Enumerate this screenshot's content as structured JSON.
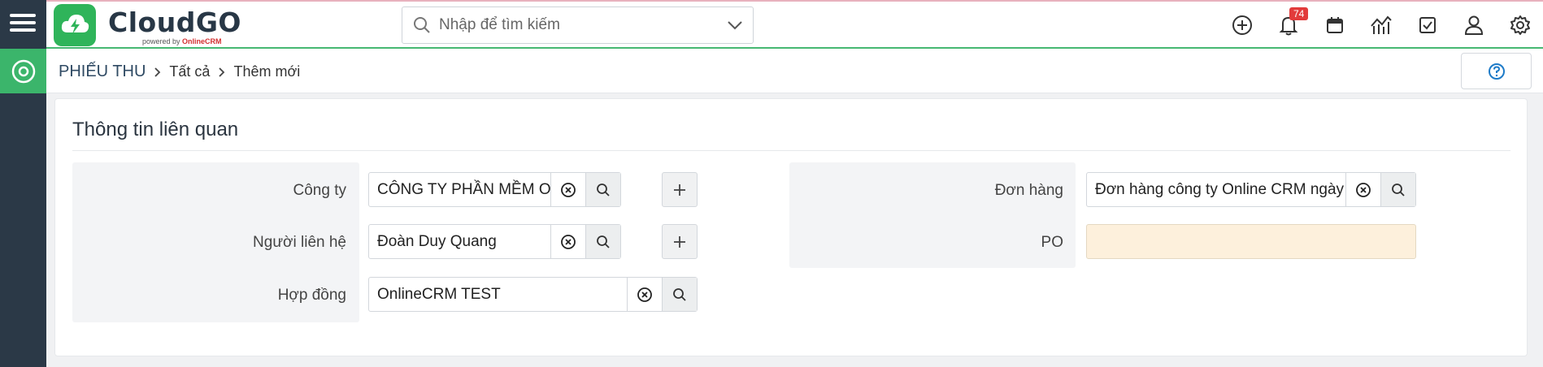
{
  "app": {
    "logo_title": "CloudGO",
    "logo_powered": "powered by",
    "logo_brand": "OnlineCRM"
  },
  "search": {
    "placeholder": "Nhập để tìm kiếm"
  },
  "notifications": {
    "count": "74"
  },
  "breadcrumb": {
    "module": "PHIẾU THU",
    "level1": "Tất cả",
    "level2": "Thêm mới"
  },
  "section": {
    "title": "Thông tin liên quan",
    "left_fields": [
      {
        "label": "Công ty",
        "value": "CÔNG TY PHẦN MỀM ONLIN"
      },
      {
        "label": "Người liên hệ",
        "value": "Đoàn Duy Quang"
      },
      {
        "label": "Hợp đồng",
        "value": "OnlineCRM TEST"
      }
    ],
    "right_fields": [
      {
        "label": "Đơn hàng",
        "value": "Đơn hàng công ty Online CRM ngày"
      },
      {
        "label": "PO",
        "value": ""
      }
    ]
  },
  "colors": {
    "sidebar": "#2b3947",
    "accent_green": "#3bb56b",
    "badge_red": "#e23b3b",
    "po_highlight": "#fdf0dc"
  }
}
